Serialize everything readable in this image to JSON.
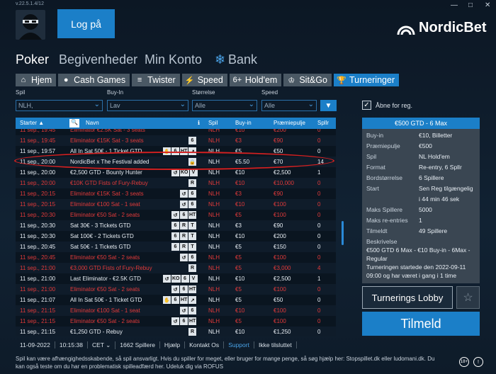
{
  "version": "v.22.5.1.4/12",
  "header": {
    "login_label": "Log på",
    "logo_text": "NordicBet",
    "win_min": "—",
    "win_max": "□",
    "win_close": "✕"
  },
  "nav": {
    "poker": "Poker",
    "events": "Begivenheder",
    "account": "Min Konto",
    "bank": "Bank"
  },
  "tabs": [
    {
      "icon": "⌂",
      "label": "Hjem"
    },
    {
      "icon": "●",
      "label": "Cash Games"
    },
    {
      "icon": "≡",
      "label": "Twister"
    },
    {
      "icon": "⚡",
      "label": "Speed"
    },
    {
      "icon": "6+",
      "label": "Hold'em"
    },
    {
      "icon": "♔",
      "label": "Sit&Go"
    },
    {
      "icon": "🏆",
      "label": "Turneringer"
    }
  ],
  "filters": {
    "game_label": "Spil",
    "buyin_label": "Buy-In",
    "size_label": "Størrelse",
    "speed_label": "Speed",
    "game_value": "NLH,",
    "buyin_value": "Lav",
    "size_value": "Alle",
    "speed_value": "Alle",
    "open_for_reg": "Åbne for reg.",
    "open_checked": "✓"
  },
  "columns": {
    "start": "Starter ▲",
    "name": "Navn",
    "info": "ℹ",
    "game": "Spil",
    "buyin": "Buy-in",
    "prize": "Præmiepulje",
    "players": "Spllr"
  },
  "rows": [
    {
      "start": "11 sep., 19:45",
      "name": "Eliminator €2.5K Sat - 3 seats",
      "badges": [],
      "game": "NLH",
      "buyin": "€10",
      "prize": "€200",
      "players": "0",
      "red": true
    },
    {
      "start": "11 sep., 19:45",
      "name": "Eliminator €15K Sat - 3 seats",
      "badges": [
        "6"
      ],
      "game": "NLH",
      "buyin": "€3",
      "prize": "€90",
      "players": "0",
      "red": true
    },
    {
      "start": "11 sep., 19:57",
      "name": "All In Sat 50€ - 1 Ticket GTD",
      "badges": [
        "✋",
        "6",
        "HT",
        "↗"
      ],
      "game": "NLH",
      "buyin": "€5",
      "prize": "€50",
      "players": "0",
      "red": false
    },
    {
      "start": "11 sep., 20:00",
      "name": "NordicBet x The Festival added",
      "badges": [
        "🔒"
      ],
      "game": "NLH",
      "buyin": "€5.50",
      "prize": "€70",
      "players": "14",
      "red": false
    },
    {
      "start": "11 sep., 20:00",
      "name": "€2,500 GTD - Bounty Hunter",
      "badges": [
        "↺",
        "KO",
        "V"
      ],
      "game": "NLH",
      "buyin": "€10",
      "prize": "€2,500",
      "players": "1",
      "red": false
    },
    {
      "start": "11 sep., 20:00",
      "name": "€10K GTD Fists of Fury-Rebuy",
      "badges": [
        "R"
      ],
      "game": "NLH",
      "buyin": "€10",
      "prize": "€10,000",
      "players": "0",
      "red": true
    },
    {
      "start": "11 sep., 20:15",
      "name": "Eliminator €15K Sat - 3 seats",
      "badges": [
        "↺",
        "6"
      ],
      "game": "NLH",
      "buyin": "€3",
      "prize": "€90",
      "players": "0",
      "red": true
    },
    {
      "start": "11 sep., 20:15",
      "name": "Eliminator €100 Sat - 1 seat",
      "badges": [
        "↺",
        "6"
      ],
      "game": "NLH",
      "buyin": "€10",
      "prize": "€100",
      "players": "0",
      "red": true
    },
    {
      "start": "11 sep., 20:30",
      "name": "Eliminator €50 Sat - 2 seats",
      "badges": [
        "↺",
        "6",
        "HT"
      ],
      "game": "NLH",
      "buyin": "€5",
      "prize": "€100",
      "players": "0",
      "red": true
    },
    {
      "start": "11 sep., 20:30",
      "name": "Sat 30€ - 3 Tickets GTD",
      "badges": [
        "6",
        "R",
        "T"
      ],
      "game": "NLH",
      "buyin": "€3",
      "prize": "€90",
      "players": "0",
      "red": false
    },
    {
      "start": "11 sep., 20:30",
      "name": "Sat 100€ - 2 Tickets GTD",
      "badges": [
        "6",
        "R",
        "T"
      ],
      "game": "NLH",
      "buyin": "€10",
      "prize": "€200",
      "players": "0",
      "red": false
    },
    {
      "start": "11 sep., 20:45",
      "name": "Sat 50€ - 1 Tickets GTD",
      "badges": [
        "6",
        "R",
        "T"
      ],
      "game": "NLH",
      "buyin": "€5",
      "prize": "€150",
      "players": "0",
      "red": false
    },
    {
      "start": "11 sep., 20:45",
      "name": "Eliminator €50 Sat - 2 seats",
      "badges": [
        "↺",
        "6"
      ],
      "game": "NLH",
      "buyin": "€5",
      "prize": "€100",
      "players": "0",
      "red": true
    },
    {
      "start": "11 sep., 21:00",
      "name": "€3,000 GTD Fists of Fury-Rebuy",
      "badges": [
        "R"
      ],
      "game": "NLH",
      "buyin": "€5",
      "prize": "€3,000",
      "players": "4",
      "red": true
    },
    {
      "start": "11 sep., 21:00",
      "name": "Last Eliminator - €2.5K GTD",
      "badges": [
        "↺",
        "KO",
        "6",
        "V"
      ],
      "game": "NLH",
      "buyin": "€10",
      "prize": "€2,500",
      "players": "1",
      "red": false
    },
    {
      "start": "11 sep., 21:00",
      "name": "Eliminator €50 Sat - 2 seats",
      "badges": [
        "↺",
        "6",
        "HT"
      ],
      "game": "NLH",
      "buyin": "€5",
      "prize": "€100",
      "players": "0",
      "red": true
    },
    {
      "start": "11 sep., 21:07",
      "name": "All In Sat 50€ - 1 Ticket GTD",
      "badges": [
        "✋",
        "6",
        "HT",
        "↗"
      ],
      "game": "NLH",
      "buyin": "€5",
      "prize": "€50",
      "players": "0",
      "red": false
    },
    {
      "start": "11 sep., 21:15",
      "name": "Eliminator €100 Sat - 1 seat",
      "badges": [
        "↺",
        "6"
      ],
      "game": "NLH",
      "buyin": "€10",
      "prize": "€100",
      "players": "0",
      "red": true
    },
    {
      "start": "11 sep., 21:15",
      "name": "Eliminator €50 Sat - 2 seats",
      "badges": [
        "↺",
        "6",
        "HT"
      ],
      "game": "NLH",
      "buyin": "€5",
      "prize": "€100",
      "players": "0",
      "red": true
    },
    {
      "start": "11 sep., 21:15",
      "name": "€1,250 GTD - Rebuy",
      "badges": [
        "R"
      ],
      "game": "NLH",
      "buyin": "€10",
      "prize": "€1,250",
      "players": "0",
      "red": false
    },
    {
      "start": "11 sep., 21:15",
      "name": "Eliminator €15K Sat - 3 seats",
      "badges": [
        "↺",
        "6",
        "HT"
      ],
      "game": "NLH",
      "buyin": "€3",
      "prize": "€90",
      "players": "0",
      "red": true
    }
  ],
  "details": {
    "title": "€500 GTD - 6 Max",
    "items": [
      {
        "k": "Buy-in",
        "v": "€10, Billetter"
      },
      {
        "k": "Præmiepulje",
        "v": "€500"
      },
      {
        "k": "Spil",
        "v": "NL Hold'em"
      },
      {
        "k": "Format",
        "v": "Re-entry, 6 Spllr"
      },
      {
        "k": "Bordstørrelse",
        "v": "6 Spillere"
      },
      {
        "k": "Start",
        "v": "Sen Reg tilgængelig"
      },
      {
        "k": "",
        "v": "i 44 min 46 sek"
      },
      {
        "k": "Maks Spillere",
        "v": "5000"
      },
      {
        "k": "Maks re-entries",
        "v": "1"
      },
      {
        "k": "Tilmeldt",
        "v": "49 Spillere"
      },
      {
        "k": "Beskrivelse",
        "v": ""
      }
    ],
    "desc1": "€500 GTD 6 Max - €10 Buy-in - 6Max -",
    "desc2": "Regular",
    "desc3": "Turneringen startede den 2022-09-11",
    "desc4": "09:00 og har været i gang i 1 time",
    "lobby": "Turnerings Lobby",
    "register": "Tilmeld",
    "star": "☆"
  },
  "status": {
    "date": "11-09-2022",
    "time": "10:15:38",
    "tz": "CET ⌄",
    "players": "1662 Spillere",
    "help": "Hjælp",
    "contact": "Kontakt Os",
    "support": "Support",
    "login": "Ikke tilsluttet"
  },
  "footer": {
    "line1": "Spil kan være afhængighedsskabende, så spil ansvarligt. Hvis du spiller for meget, eller bruger for mange penge, så søg hjælp her: Stopspillet.dk eller ludomani.dk. Du",
    "line2": "kan også teste om du har en problematisk spilleadfærd her. Udeluk dig via ROFUS",
    "age": "18+"
  }
}
